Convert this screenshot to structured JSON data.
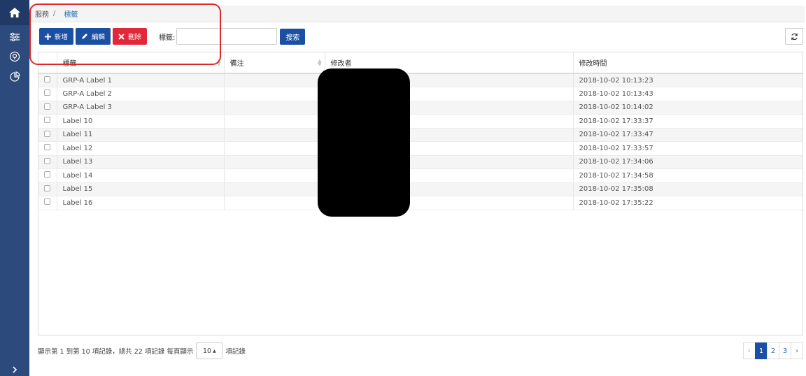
{
  "breadcrumb": {
    "parent": "服務",
    "separator": "/",
    "current": "標籤"
  },
  "toolbar": {
    "add": "新增",
    "edit": "編輯",
    "delete": "刪除",
    "tag_label": "標籤:",
    "tag_input_value": "",
    "search": "搜索"
  },
  "table": {
    "headers": {
      "tag": "標籤",
      "note": "備注",
      "modifier": "修改者",
      "modified_time": "修改時間"
    },
    "rows": [
      {
        "tag": "GRP-A Label 1",
        "note": "",
        "modifier": "",
        "time": "2018-10-02 10:13:23"
      },
      {
        "tag": "GRP-A Label 2",
        "note": "",
        "modifier": "",
        "time": "2018-10-02 10:13:43"
      },
      {
        "tag": "GRP-A Label 3",
        "note": "",
        "modifier": "",
        "time": "2018-10-02 10:14:02"
      },
      {
        "tag": "Label 10",
        "note": "",
        "modifier": "",
        "time": "2018-10-02 17:33:37"
      },
      {
        "tag": "Label 11",
        "note": "",
        "modifier": "",
        "time": "2018-10-02 17:33:47"
      },
      {
        "tag": "Label 12",
        "note": "",
        "modifier": "",
        "time": "2018-10-02 17:33:57"
      },
      {
        "tag": "Label 13",
        "note": "",
        "modifier": "",
        "time": "2018-10-02 17:34:06"
      },
      {
        "tag": "Label 14",
        "note": "",
        "modifier": "",
        "time": "2018-10-02 17:34:58"
      },
      {
        "tag": "Label 15",
        "note": "",
        "modifier": "",
        "time": "2018-10-02 17:35:08"
      },
      {
        "tag": "Label 16",
        "note": "",
        "modifier": "",
        "time": "2018-10-02 17:35:22"
      }
    ]
  },
  "footer": {
    "summary": "顯示第 1 到第 10 項記錄，總共 22 項記錄 每頁顯示",
    "per_page": "10",
    "suffix": "項記錄"
  },
  "pagination": {
    "prev": "‹",
    "pages": [
      "1",
      "2",
      "3"
    ],
    "next": "›",
    "active": "1"
  },
  "icons": [
    "home-icon",
    "sliders-icon",
    "help-circle-icon",
    "pie-chart-icon",
    "chevron-right-icon",
    "plus-icon",
    "pencil-icon",
    "x-icon",
    "refresh-icon"
  ],
  "colors": {
    "sidebar": "#2c4a7c",
    "primary": "#1a4fa3",
    "danger": "#e0283a",
    "link": "#2d6fb6",
    "highlight": "#e02828"
  }
}
